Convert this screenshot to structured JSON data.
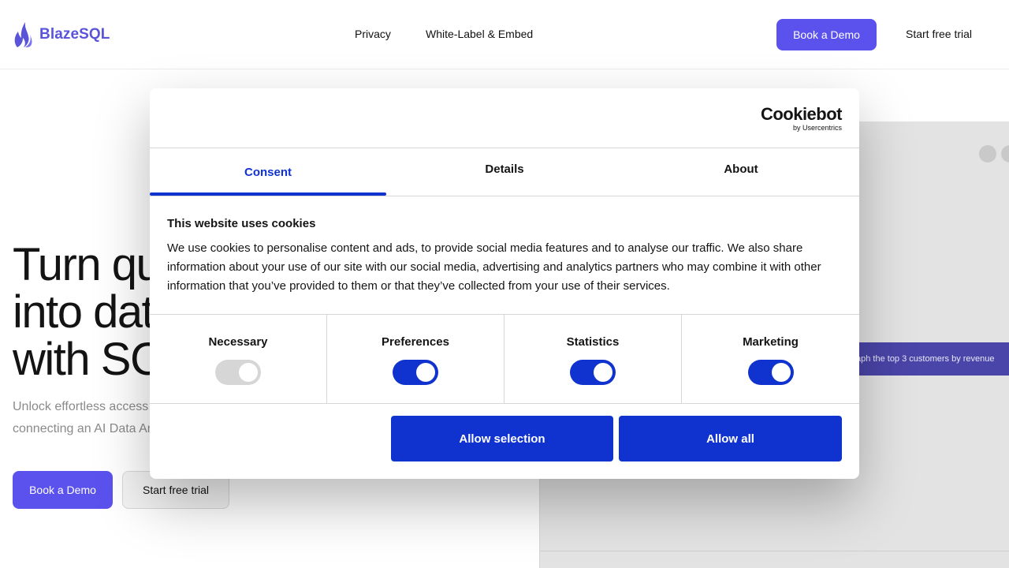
{
  "header": {
    "brand": "BlazeSQL",
    "nav": [
      "Privacy",
      "White-Label & Embed"
    ],
    "book_demo": "Book a Demo",
    "start_trial": "Start free trial"
  },
  "hero": {
    "title_lines": [
      "Turn qu",
      "into dat",
      "with SC"
    ],
    "subtitle_lines": [
      "Unlock effortless access",
      "connecting an AI Data An"
    ],
    "book_demo": "Book a Demo",
    "start_trial": "Start free trial"
  },
  "preview": {
    "prompt": "aph the top 3 customers by revenue"
  },
  "cookie_dialog": {
    "brand": "Cookiebot",
    "brand_sub": "by Usercentrics",
    "tabs": [
      "Consent",
      "Details",
      "About"
    ],
    "active_tab": "Consent",
    "heading": "This website uses cookies",
    "body": "We use cookies to personalise content and ads, to provide social media features and to analyse our traffic. We also share information about your use of our site with our social media, advertising and analytics partners who may combine it with other information that you’ve provided to them or that they’ve collected from your use of their services.",
    "categories": [
      {
        "label": "Necessary",
        "enabled": true,
        "locked": true
      },
      {
        "label": "Preferences",
        "enabled": true
      },
      {
        "label": "Statistics",
        "enabled": true
      },
      {
        "label": "Marketing",
        "enabled": true
      }
    ],
    "allow_selection": "Allow selection",
    "allow_all": "Allow all"
  },
  "colors": {
    "brand_purple": "#5b52ee",
    "cookiebot_blue": "#1032cf"
  }
}
